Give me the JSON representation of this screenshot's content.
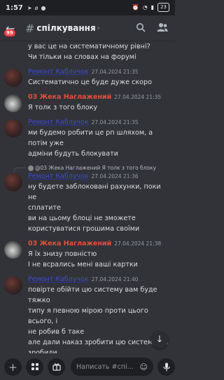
{
  "status_bar": {
    "time": "1:57",
    "battery": "23"
  },
  "header": {
    "title": "спілкування",
    "badge": "99"
  },
  "messages": {
    "cont_lines": [
      "у вас це на систематичному рівні?",
      "Чи тільки на словах на форумі"
    ],
    "m1": {
      "author": "Ремонт Каблучок",
      "time": "27.04.2024 21:35",
      "lines": [
        "Систематично це буде дуже скоро"
      ]
    },
    "m2": {
      "author": "03 Жека Наглажений",
      "time": "27.04.2024 21:35",
      "lines": [
        "Я толк з того блоку"
      ]
    },
    "m3": {
      "author": "Ремонт Каблучок",
      "time": "27.04.2024 21:35",
      "lines": [
        "ми будемо робити це рп шляхом, а потім уже",
        "адміни будуть блокувати"
      ]
    },
    "m4": {
      "reply_text": "@03 Жека Наглажений Я толк з того блоку",
      "author": "Ремонт Каблучок",
      "time": "27.04.2024 21:36",
      "lines": [
        "ну будете заблоковані рахунки, поки не",
        "сплатите",
        "ви на цьому блоці не зможете",
        "користуватися грошима своїми"
      ]
    },
    "m5": {
      "author": "03 Жека Наглажений",
      "time": "27.04.2024 21:38",
      "lines": [
        "Я їх знизу повністю",
        "І не всрались мені ваші картки"
      ]
    },
    "m6": {
      "author": "Ремонт Каблучок",
      "time": "27.04.2024 21:40",
      "lines": [
        "повірте обійти цю систему вам буде тяжко",
        "типу я певною мірою проти цього всього, і",
        "не робив б таке",
        "але дали наказ зробити цю систему ми",
        "зробили"
      ]
    }
  },
  "composer": {
    "placeholder": "Написать #спі..."
  },
  "icons": {
    "back": "arrow-left-icon",
    "search": "search-icon",
    "people": "people-icon",
    "add": "plus-icon",
    "mic": "microphone-icon",
    "emoji": "emoji-icon",
    "scroll": "arrow-down-icon"
  },
  "colors": {
    "background": "#313338",
    "link_name": "#3e4ad6",
    "alt_name": "#e74c3c",
    "badge": "#f23f43"
  }
}
